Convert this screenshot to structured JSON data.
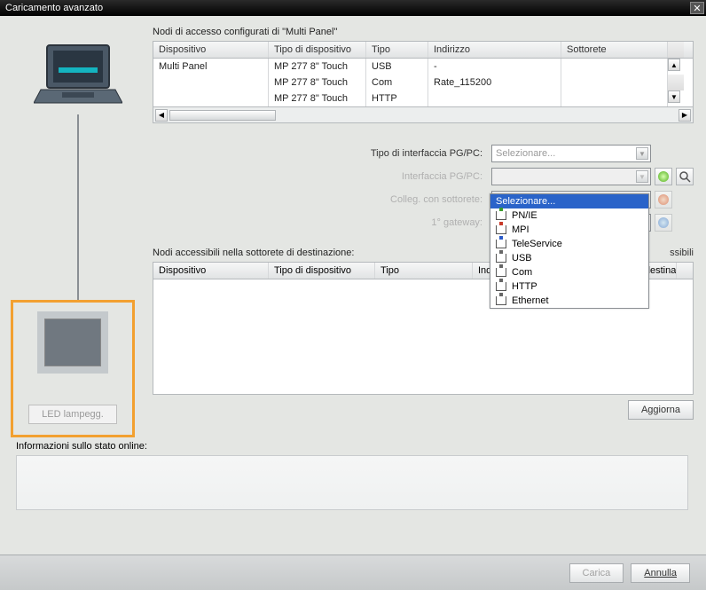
{
  "title": "Caricamento avanzato",
  "sections": {
    "top_label": "Nodi di accesso configurati di \"Multi Panel\"",
    "accessible_label": "Nodi accessibili nella sottorete di destinazione:",
    "info_label": "Informazioni sullo stato online:"
  },
  "top_grid": {
    "headers": {
      "dev": "Dispositivo",
      "type": "Tipo di dispositivo",
      "tipo": "Tipo",
      "addr": "Indirizzo",
      "sub": "Sottorete"
    },
    "rows": [
      {
        "dev": "Multi Panel",
        "type": "MP 277 8\" Touch",
        "tipo": "USB",
        "addr": "-",
        "sub": ""
      },
      {
        "dev": "",
        "type": "MP 277 8\" Touch",
        "tipo": "Com",
        "addr": "Rate_115200",
        "sub": ""
      },
      {
        "dev": "",
        "type": "MP 277 8\" Touch",
        "tipo": "HTTP",
        "addr": "",
        "sub": ""
      }
    ]
  },
  "form": {
    "pgpc_type_label": "Tipo di interfaccia PG/PC:",
    "pgpc_if_label": "Interfaccia PG/PC:",
    "subnet_label": "Colleg. con sottorete:",
    "gateway_label": "1° gateway:",
    "placeholder": "Selezionare..."
  },
  "dropdown_options": [
    {
      "label": "Selezionare...",
      "icon": ""
    },
    {
      "label": "PN/IE",
      "icon": "green"
    },
    {
      "label": "MPI",
      "icon": "red"
    },
    {
      "label": "TeleService",
      "icon": "blue"
    },
    {
      "label": "USB",
      "icon": "gray"
    },
    {
      "label": "Com",
      "icon": "gray"
    },
    {
      "label": "HTTP",
      "icon": "gray"
    },
    {
      "label": "Ethernet",
      "icon": "gray"
    }
  ],
  "dest_grid": {
    "headers": {
      "dev": "Dispositivo",
      "type": "Tipo di dispositivo",
      "tipo": "Tipo",
      "addr": "Indirizzo",
      "dest": "Dispositivo di destinazi..."
    },
    "overlay_partial": "ssibili"
  },
  "buttons": {
    "led": "LED lampegg.",
    "aggiorna": "Aggiorna",
    "carica": "Carica",
    "annulla": "Annulla"
  }
}
